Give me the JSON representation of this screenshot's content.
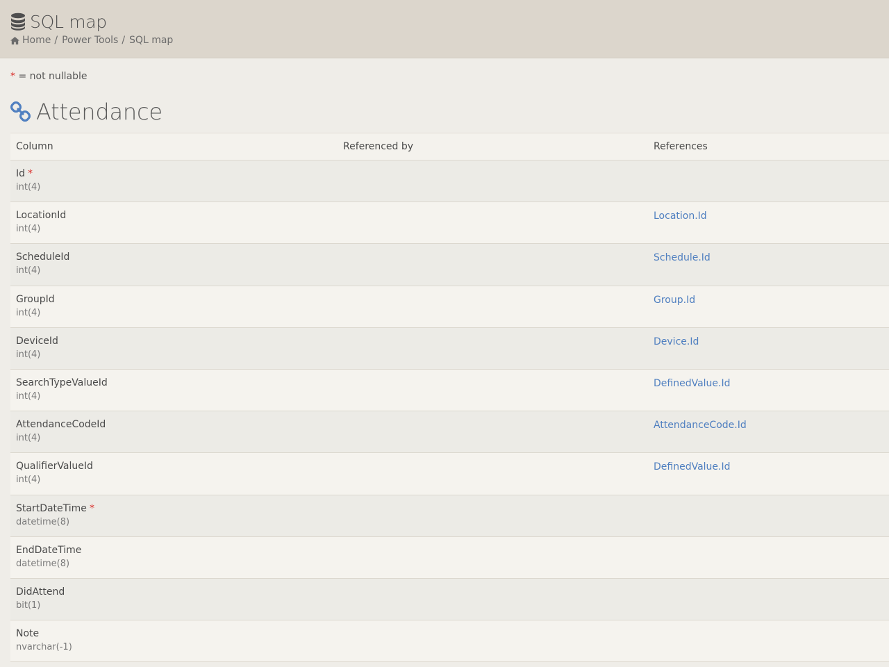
{
  "header": {
    "title": "SQL map",
    "breadcrumbs": [
      "Home",
      "Power Tools",
      "SQL map"
    ]
  },
  "legend": {
    "marker": "*",
    "text": " = not nullable"
  },
  "table": {
    "name": "Attendance",
    "columns_header": {
      "column": "Column",
      "referenced_by": "Referenced by",
      "references": "References"
    },
    "rows": [
      {
        "name": "Id",
        "required": true,
        "type": "int(4)",
        "referenced_by": "",
        "references": ""
      },
      {
        "name": "LocationId",
        "required": false,
        "type": "int(4)",
        "referenced_by": "",
        "references": "Location.Id"
      },
      {
        "name": "ScheduleId",
        "required": false,
        "type": "int(4)",
        "referenced_by": "",
        "references": "Schedule.Id"
      },
      {
        "name": "GroupId",
        "required": false,
        "type": "int(4)",
        "referenced_by": "",
        "references": "Group.Id"
      },
      {
        "name": "DeviceId",
        "required": false,
        "type": "int(4)",
        "referenced_by": "",
        "references": "Device.Id"
      },
      {
        "name": "SearchTypeValueId",
        "required": false,
        "type": "int(4)",
        "referenced_by": "",
        "references": "DefinedValue.Id"
      },
      {
        "name": "AttendanceCodeId",
        "required": false,
        "type": "int(4)",
        "referenced_by": "",
        "references": "AttendanceCode.Id"
      },
      {
        "name": "QualifierValueId",
        "required": false,
        "type": "int(4)",
        "referenced_by": "",
        "references": "DefinedValue.Id"
      },
      {
        "name": "StartDateTime",
        "required": true,
        "type": "datetime(8)",
        "referenced_by": "",
        "references": ""
      },
      {
        "name": "EndDateTime",
        "required": false,
        "type": "datetime(8)",
        "referenced_by": "",
        "references": ""
      },
      {
        "name": "DidAttend",
        "required": false,
        "type": "bit(1)",
        "referenced_by": "",
        "references": ""
      },
      {
        "name": "Note",
        "required": false,
        "type": "nvarchar(-1)",
        "referenced_by": "",
        "references": ""
      }
    ]
  },
  "icons": {
    "title": "database-icon",
    "home": "home-icon",
    "table": "link-icon"
  },
  "colors": {
    "header_bg": "#dcd6cc",
    "page_bg": "#efede8",
    "link": "#4f7fc0",
    "required": "#d9302c"
  }
}
